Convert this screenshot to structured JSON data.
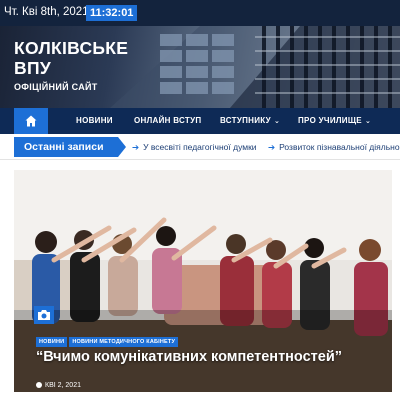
{
  "topbar": {
    "date": "Чт. Кві 8th, 2021",
    "time": "11:32:01"
  },
  "site": {
    "title_line1": "КОЛКІВСЬКЕ",
    "title_line2": "ВПУ",
    "subtitle": "ОФІЦІЙНИЙ САЙТ"
  },
  "nav": {
    "home_icon": "home-icon",
    "items": [
      {
        "label": "НОВИНИ",
        "dropdown": false
      },
      {
        "label": "ОНЛАЙН ВСТУП",
        "dropdown": false
      },
      {
        "label": "ВСТУПНИКУ",
        "dropdown": true
      },
      {
        "label": "ПРО УЧИЛИЩЕ",
        "dropdown": true
      }
    ],
    "chevron": "⌄"
  },
  "latest": {
    "label": "Останні записи",
    "links": [
      "У всесвіті педагогічної думки",
      "Розвиток пізнавальної діяльно"
    ]
  },
  "feature": {
    "tags": [
      "НОВИНИ",
      "НОВИНИ МЕТОДИЧНОГО КАБІНЕТУ"
    ],
    "headline": "“Вчимо комунікативних компетентностей”",
    "date": "КВІ 2, 2021",
    "camera_icon": "camera-icon"
  },
  "colors": {
    "topbar": "#13233d",
    "nav": "#0e2a56",
    "accent": "#1d6fd6"
  }
}
